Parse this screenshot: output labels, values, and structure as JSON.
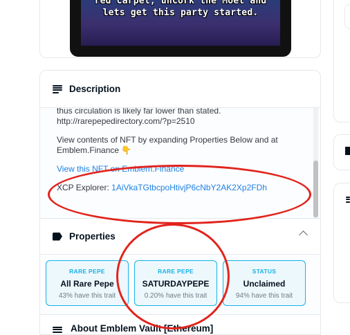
{
  "nft_image": {
    "caption_line1": "red carpet, uncork the Moet and",
    "caption_line2": "lets get this party started."
  },
  "description": {
    "title": "Description",
    "paragraphs": {
      "p1_line1": "thus circulation is likely far lower than stated.",
      "p1_line2": "http://rarepepedirectory.com/?p=2510",
      "p2": "View contents of NFT by expanding Properties Below and at Emblem.Finance 👇",
      "link_label": "View this NFT on Emblem.Finance",
      "xcp_label": "XCP Explorer: ",
      "xcp_link": "1AiVkaTGtbcpoHtivjP6cNbY2AK2Xp2FDh"
    }
  },
  "properties": {
    "title": "Properties",
    "items": [
      {
        "type": "RARE PEPE",
        "value": "All Rare Pepe",
        "rarity": "43% have this trait"
      },
      {
        "type": "RARE PEPE",
        "value": "SATURDAYPEPE",
        "rarity": "0.20% have this trait"
      },
      {
        "type": "STATUS",
        "value": "Unclaimed",
        "rarity": "94% have this trait"
      }
    ]
  },
  "next_section": {
    "title": "About Emblem Vault [Ethereum]"
  },
  "colors": {
    "accent": "#15b2e5",
    "link": "#2081e2",
    "annotation": "#e1231c"
  }
}
